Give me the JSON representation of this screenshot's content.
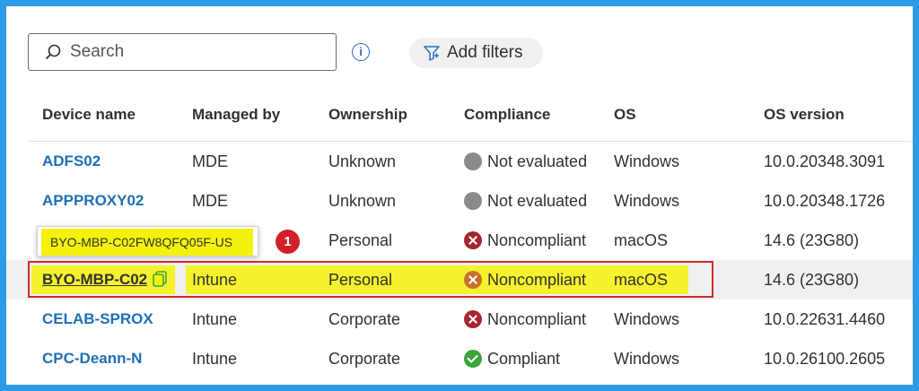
{
  "search": {
    "placeholder": "Search"
  },
  "info_icon_glyph": "i",
  "filters": {
    "label": "Add filters"
  },
  "columns": [
    "Device name",
    "Managed by",
    "Ownership",
    "Compliance",
    "OS",
    "OS version"
  ],
  "rows": [
    {
      "device": "ADFS02",
      "managed_by": "MDE",
      "ownership": "Unknown",
      "compliance": "Not evaluated",
      "compliance_icon": "grey-circle-icon",
      "os": "Windows",
      "os_version": "10.0.20348.3091"
    },
    {
      "device": "APPPROXY02",
      "managed_by": "MDE",
      "ownership": "Unknown",
      "compliance": "Not evaluated",
      "compliance_icon": "grey-circle-icon",
      "os": "Windows",
      "os_version": "10.0.20348.1726"
    },
    {
      "device": "",
      "managed_by": "",
      "ownership": "Personal",
      "compliance": "Noncompliant",
      "compliance_icon": "red-x-icon",
      "os": "macOS",
      "os_version": "14.6 (23G80)"
    },
    {
      "device": "BYO-MBP-C02",
      "managed_by": "Intune",
      "ownership": "Personal",
      "compliance": "Noncompliant",
      "compliance_icon": "red-x-icon",
      "os": "macOS",
      "os_version": "14.6 (23G80)"
    },
    {
      "device": "CELAB-SPROX",
      "managed_by": "Intune",
      "ownership": "Corporate",
      "compliance": "Noncompliant",
      "compliance_icon": "red-x-icon",
      "os": "Windows",
      "os_version": "10.0.22631.4460"
    },
    {
      "device": "CPC-Deann-N",
      "managed_by": "Intune",
      "ownership": "Corporate",
      "compliance": "Compliant",
      "compliance_icon": "green-check-icon",
      "os": "Windows",
      "os_version": "10.0.26100.2605"
    }
  ],
  "tooltip": {
    "text": "BYO-MBP-C02FW8QFQ05F-US"
  },
  "callout_badge": "1",
  "colors": {
    "link": "#1f6fb7",
    "highlight": "#f4f20a",
    "annotation_red": "#d42a2a",
    "frame_border": "#2d9be8"
  }
}
